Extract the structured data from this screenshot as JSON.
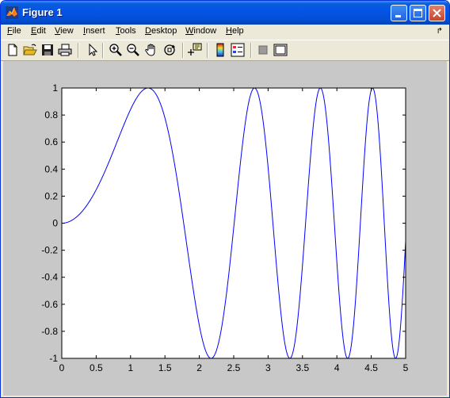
{
  "window": {
    "title": "Figure 1",
    "app_icon": "matlab-icon",
    "buttons": [
      "minimize-icon",
      "maximize-icon",
      "close-icon"
    ]
  },
  "menubar": {
    "items": [
      {
        "label": "File",
        "accel": "F"
      },
      {
        "label": "Edit",
        "accel": "E"
      },
      {
        "label": "View",
        "accel": "V"
      },
      {
        "label": "Insert",
        "accel": "I"
      },
      {
        "label": "Tools",
        "accel": "T"
      },
      {
        "label": "Desktop",
        "accel": "D"
      },
      {
        "label": "Window",
        "accel": "W"
      },
      {
        "label": "Help",
        "accel": "H"
      }
    ],
    "dock_icon": "dock-arrow-icon"
  },
  "toolbar": {
    "tools": [
      "new-figure-icon",
      "open-file-icon",
      "save-icon",
      "print-icon",
      "edit-plot-icon",
      "zoom-in-icon",
      "zoom-out-icon",
      "pan-icon",
      "rotate-3d-icon",
      "data-cursor-icon",
      "insert-colorbar-icon",
      "insert-legend-icon",
      "hide-plot-tools-icon",
      "show-plot-tools-icon"
    ]
  },
  "colors": {
    "figure_bg": "#c8c8c8",
    "axes_bg": "#ffffff",
    "line": "#0000ff",
    "titlebar": "#0453e6"
  },
  "chart_data": {
    "type": "line",
    "title": "",
    "xlabel": "",
    "ylabel": "",
    "xlim": [
      0,
      5
    ],
    "ylim": [
      -1,
      1
    ],
    "grid": false,
    "legend": null,
    "xticks": [
      0,
      0.5,
      1,
      1.5,
      2,
      2.5,
      3,
      3.5,
      4,
      4.5,
      5
    ],
    "xtick_labels": [
      "0",
      "0.5",
      "1",
      "1.5",
      "2",
      "2.5",
      "3",
      "3.5",
      "4",
      "4.5",
      "5"
    ],
    "yticks": [
      -1,
      -0.8,
      -0.6,
      -0.4,
      -0.2,
      0,
      0.2,
      0.4,
      0.6,
      0.8,
      1
    ],
    "ytick_labels": [
      "-1",
      "-0.8",
      "-0.6",
      "-0.4",
      "-0.2",
      "0",
      "0.2",
      "0.4",
      "0.6",
      "0.8",
      "1"
    ],
    "series": [
      {
        "function": "sin(x^2)",
        "x": [
          0,
          0.25,
          0.5,
          0.75,
          1.0,
          1.1,
          1.2533,
          1.4,
          1.6,
          1.77,
          1.9,
          2.0,
          2.1708,
          2.3,
          2.5,
          2.6,
          2.8025,
          3.0,
          3.07,
          3.2,
          3.3,
          3.316,
          3.4,
          3.5449,
          3.6,
          3.7599,
          3.8,
          3.9,
          3.9633,
          4.1,
          4.1569,
          4.3,
          4.3416,
          4.4,
          4.5,
          4.5158,
          4.6,
          4.6835,
          4.8,
          4.8453,
          4.9,
          5.0
        ],
        "y": [
          0,
          0.0625,
          0.2474,
          0.5333,
          0.8415,
          0.9356,
          1.0,
          0.9254,
          0.5487,
          0.0076,
          -0.4491,
          -0.7568,
          -1.0,
          -0.8322,
          -0.0332,
          0.4444,
          1.0,
          0.4121,
          0.0,
          -0.7096,
          -0.9811,
          -1.0,
          -0.8677,
          0.0,
          0.4159,
          1.0,
          0.8992,
          0.1942,
          0.0,
          -0.8937,
          -1.0,
          -0.269,
          0.0,
          0.4349,
          0.9711,
          1.0,
          0.7245,
          0.0,
          -0.9869,
          -1.0,
          -0.2846,
          -0.1324
        ]
      }
    ]
  }
}
